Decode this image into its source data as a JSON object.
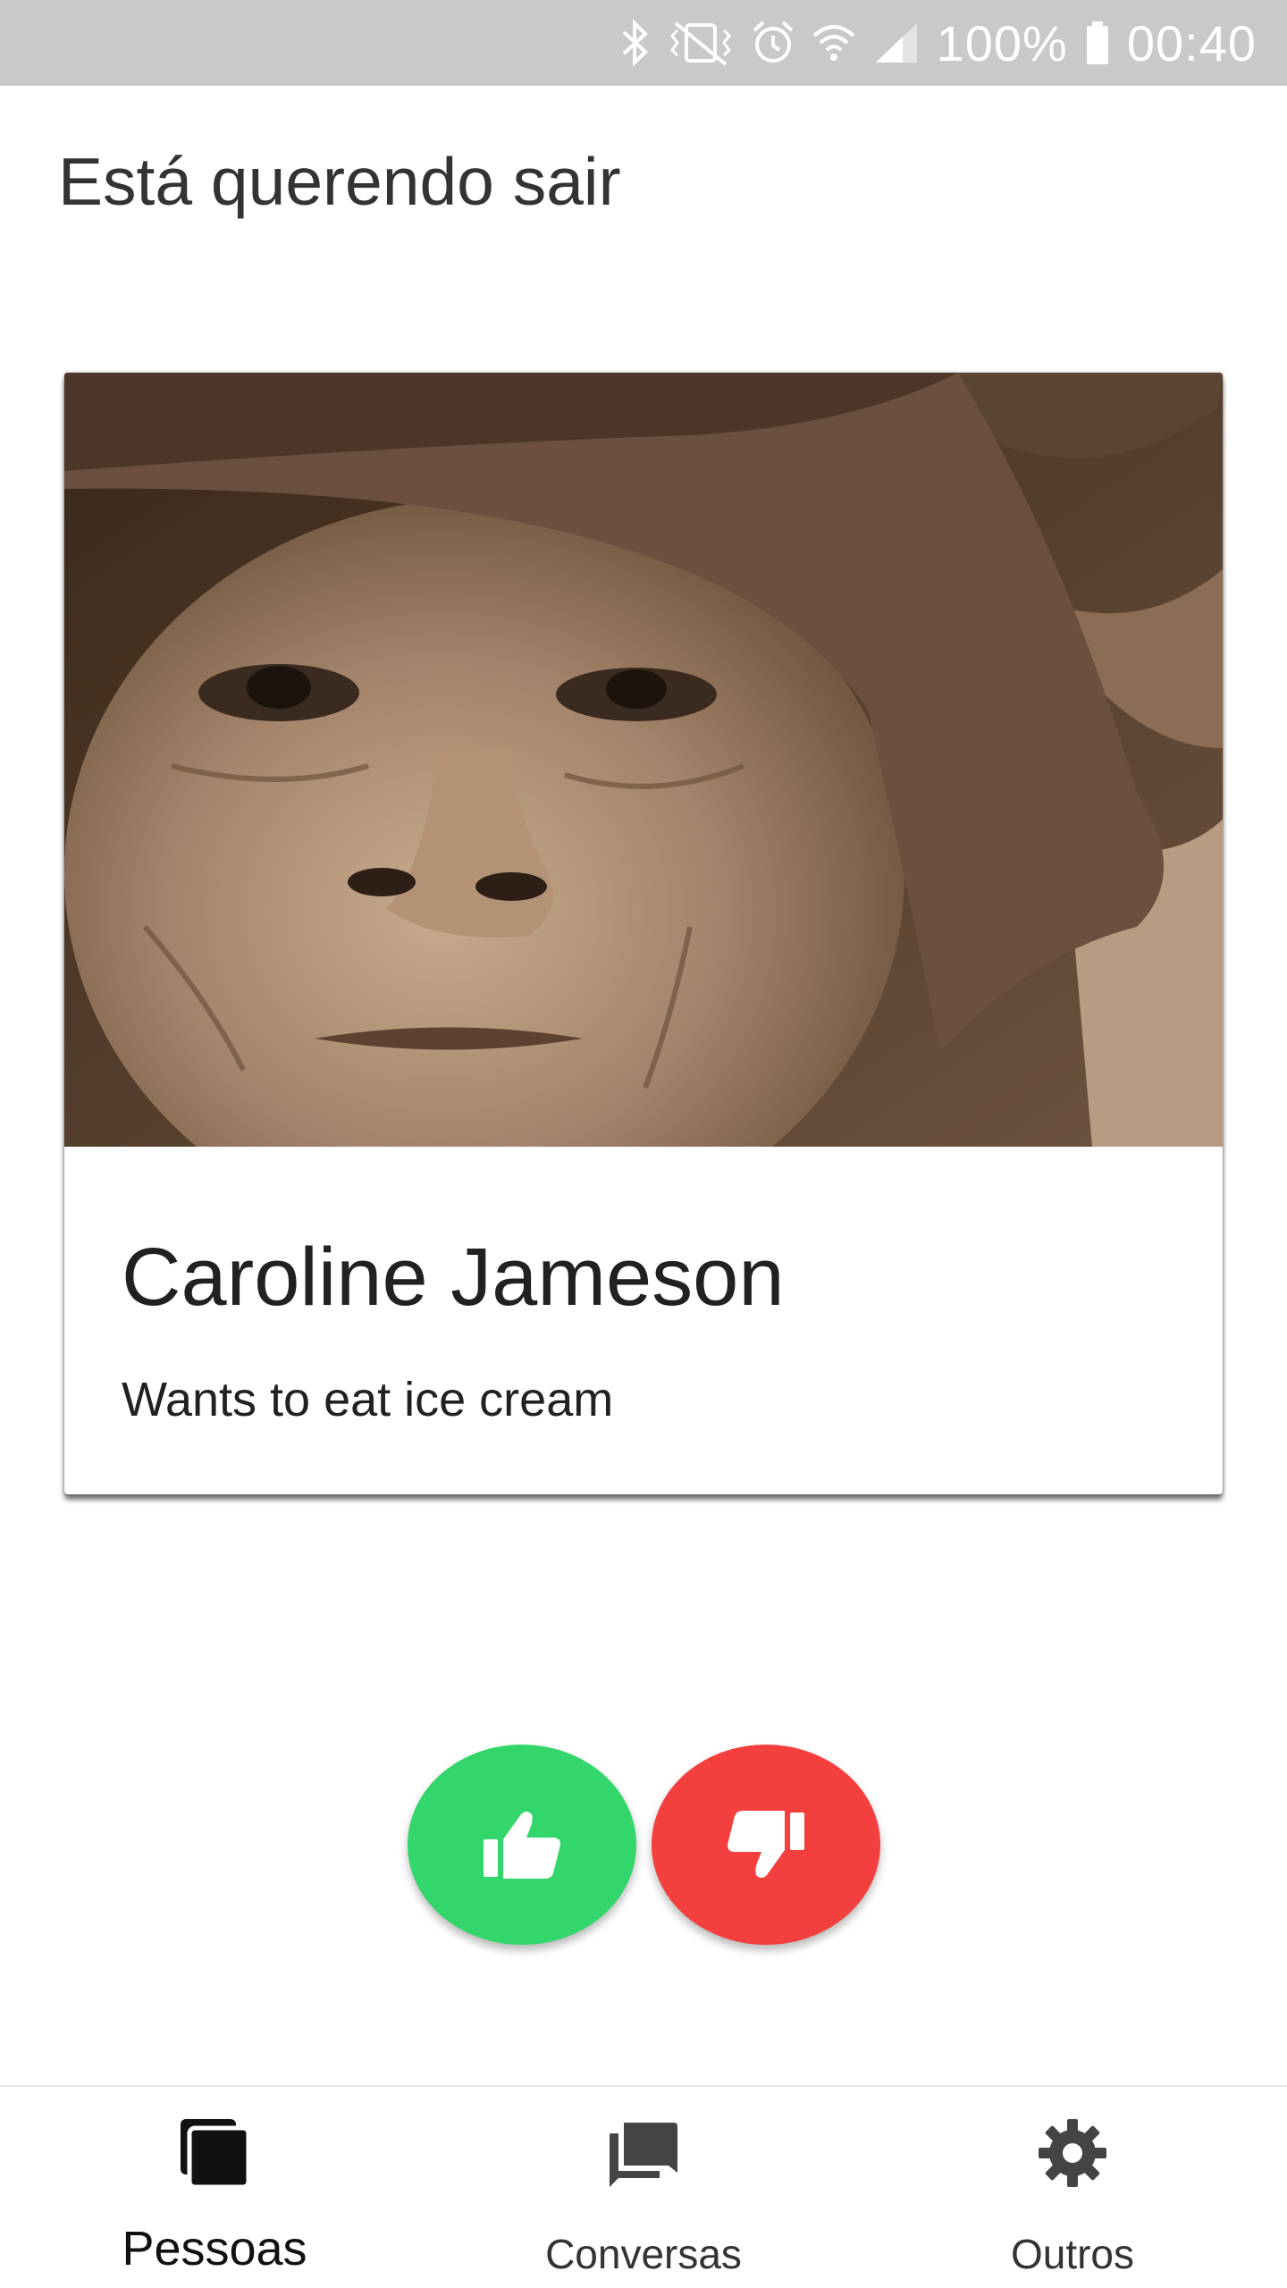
{
  "status_bar": {
    "battery_text": "100%",
    "time": "00:40",
    "icons": [
      "bluetooth-icon",
      "vibrate-mute-icon",
      "alarm-icon",
      "wifi-icon",
      "signal-icon",
      "battery-icon"
    ]
  },
  "header": {
    "title": "Está querendo sair"
  },
  "card": {
    "name": "Caroline Jameson",
    "description": "Wants to eat ice cream"
  },
  "actions": {
    "like_icon": "thumbs-up-icon",
    "dislike_icon": "thumbs-down-icon",
    "like_color": "#33d66a",
    "dislike_color": "#f43f3f"
  },
  "bottom_nav": {
    "items": [
      {
        "label": "Pessoas",
        "icon": "cards-stack-icon",
        "active": true
      },
      {
        "label": "Conversas",
        "icon": "chat-icon",
        "active": false
      },
      {
        "label": "Outros",
        "icon": "gear-icon",
        "active": false
      }
    ]
  }
}
